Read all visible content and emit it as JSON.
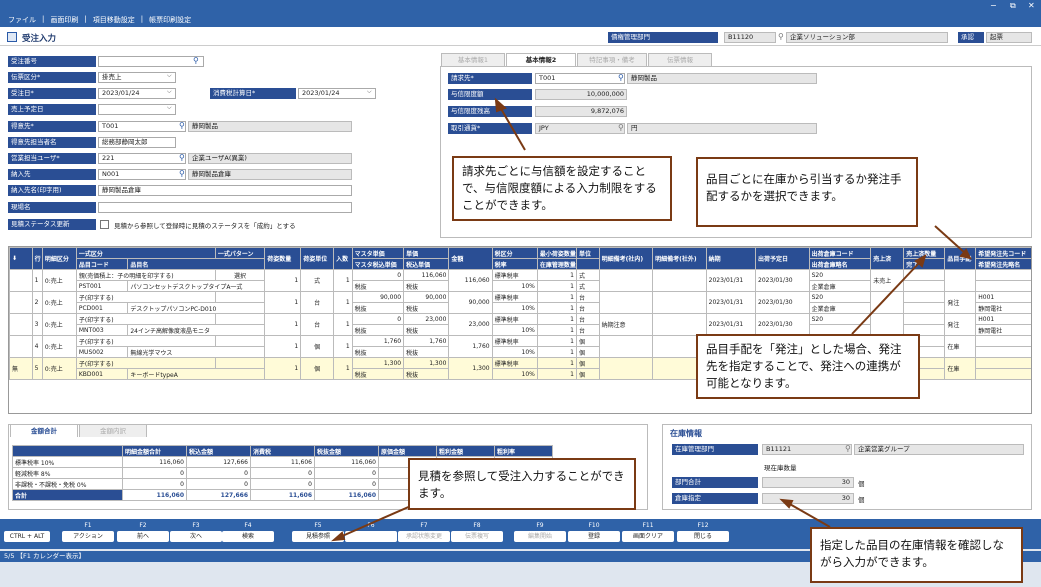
{
  "window": {
    "min": "−",
    "restore": "⧉",
    "close": "✕"
  },
  "menu": [
    "ファイル",
    "|",
    "画面印刷",
    "|",
    "項目移動設定",
    "|",
    "帳票印刷設定"
  ],
  "page": {
    "title": "受注入力"
  },
  "header": {
    "dept_label": "債権管理部門",
    "dept_code": "B11120",
    "dept_name": "企業ソリューション部",
    "approve_label": "承認",
    "approve_value": "起票"
  },
  "form": {
    "order_no_label": "受注番号",
    "order_no": "",
    "slip_type_label": "伝票区分*",
    "slip_type": "掛売上",
    "order_date_label": "受注日*",
    "order_date": "2023/01/24",
    "tax_date_label": "消費税計算日*",
    "tax_date": "2023/01/24",
    "sales_plan_label": "売上予定日",
    "sales_plan": "",
    "customer_label": "得意先*",
    "customer_code": "T001",
    "customer_name": "静岡製品",
    "contact_label": "得意先担当者名",
    "contact": "総務部静岡太郎",
    "rep_label": "営業担当ユーザ*",
    "rep_code": "221",
    "rep_name": "企業ユーザA(異業)",
    "ship_label": "納入先",
    "ship_code": "N001",
    "ship_name": "静岡製品倉庫",
    "ship_name_label": "納入先名(印字用)",
    "ship_name_print": "静岡製品倉庫",
    "site_label": "現場名",
    "site": "",
    "quote_label": "見積ステータス更新",
    "quote_text": "見積から参照して登録時に見積のステータスを「成約」とする"
  },
  "tabs": [
    "基本情報1",
    "基本情報2",
    "特記事項・備考",
    "伝票情報"
  ],
  "basic2": {
    "bill_label": "請求先*",
    "bill_code": "T001",
    "bill_name": "静岡製品",
    "limit_label": "与信限度額",
    "limit": "10,000,000",
    "limit_rest_label": "与信限度残高",
    "limit_rest": "9,872,076",
    "currency_label": "取引通貨*",
    "currency_code": "JPY",
    "currency_name": "円"
  },
  "grid": {
    "h1": [
      "行",
      "明細区分",
      "一式区分",
      "一式パターン",
      "荷姿数量",
      "荷姿単位",
      "入数",
      "マスタ単価",
      "単価",
      "金額",
      "税区分",
      "最小荷姿数量",
      "単位",
      "明細備考(社内)",
      "明細備考(社外)",
      "納期",
      "出荷予定日",
      "出荷倉庫コード",
      "売上済",
      "売上済数量",
      "品目手配",
      "希望発注先コード"
    ],
    "h2": [
      "品目コード",
      "品目名",
      "マスタ税込単価",
      "税込単価",
      "税率",
      "在庫管理数量",
      "出荷倉庫略名",
      "完了",
      "希望発注先略名"
    ],
    "rows": [
      {
        "no": "1",
        "kind": "0:売上",
        "set": "親(売価積上：子の明細を印字する)",
        "pattern": "選択",
        "code": "PST001",
        "name": "パソコンセットデスクトップタイプA一式",
        "qty": "1",
        "unit": "式",
        "inner": "1",
        "m_price": "0",
        "price": "116,060",
        "amount": "116,060",
        "tax": "標準税率",
        "min": "1",
        "tax_rate": "10%",
        "stock": "1",
        "u": "式",
        "memo_in": "",
        "due": "2023/01/31",
        "ship": "2023/01/30",
        "wh": "S20",
        "wh_name": "企業倉庫",
        "sold": "未売上",
        "arrange": "",
        "vendor": "",
        "vendor_name": "",
        "taxlbl": "税抜"
      },
      {
        "no": "2",
        "kind": "0:売上",
        "set": "子(印字する)",
        "pattern": "",
        "code": "PCD001",
        "name": "デスクトップパソコンPC-D010",
        "qty": "1",
        "unit": "台",
        "inner": "1",
        "m_price": "90,000",
        "price": "90,000",
        "amount": "90,000",
        "tax": "標準税率",
        "min": "1",
        "tax_rate": "10%",
        "stock": "1",
        "u": "台",
        "memo_in": "",
        "due": "2023/01/31",
        "ship": "2023/01/30",
        "wh": "S20",
        "wh_name": "企業倉庫",
        "sold": "",
        "arrange": "発注",
        "vendor": "H001",
        "vendor_name": "静岡電社",
        "taxlbl": "税抜"
      },
      {
        "no": "3",
        "kind": "0:売上",
        "set": "子(印字する)",
        "pattern": "",
        "code": "MNT003",
        "name": "24インチ高解像度液晶モニタ",
        "qty": "1",
        "unit": "台",
        "inner": "1",
        "m_price": "0",
        "price": "23,000",
        "amount": "23,000",
        "tax": "標準税率",
        "min": "1",
        "tax_rate": "10%",
        "stock": "1",
        "u": "台",
        "memo_in": "納期注意",
        "due": "2023/01/31",
        "ship": "2023/01/30",
        "wh": "S20",
        "wh_name": "",
        "sold": "",
        "arrange": "発注",
        "vendor": "H001",
        "vendor_name": "静岡電社",
        "taxlbl": "税抜"
      },
      {
        "no": "4",
        "kind": "0:売上",
        "set": "子(印字する)",
        "pattern": "",
        "code": "MUS002",
        "name": "無線光学マウス",
        "qty": "1",
        "unit": "個",
        "inner": "1",
        "m_price": "1,760",
        "price": "1,760",
        "amount": "1,760",
        "tax": "標準税率",
        "min": "1",
        "tax_rate": "10%",
        "stock": "1",
        "u": "個",
        "memo_in": "",
        "due": "",
        "ship": "",
        "wh": "",
        "wh_name": "",
        "sold": "",
        "arrange": "在庫",
        "vendor": "",
        "vendor_name": "",
        "taxlbl": "税抜"
      },
      {
        "no": "5",
        "kind": "0:売上",
        "set": "子(印字する)",
        "pattern": "",
        "code": "KBD001",
        "name": "キーボードtypeA",
        "qty": "1",
        "unit": "個",
        "inner": "1",
        "m_price": "1,300",
        "price": "1,300",
        "amount": "1,300",
        "tax": "標準税率",
        "min": "1",
        "tax_rate": "10%",
        "stock": "1",
        "u": "個",
        "memo_in": "",
        "due": "",
        "ship": "",
        "wh": "",
        "wh_name": "",
        "sold": "",
        "arrange": "在庫",
        "vendor": "",
        "vendor_name": "",
        "taxlbl": "税抜"
      }
    ],
    "row5_mark": "無"
  },
  "totals": {
    "tabs": [
      "金額合計",
      "金額内訳"
    ],
    "headers": [
      "明細金額合計",
      "税込金額",
      "消費税",
      "税抜金額",
      "原価金額",
      "粗利金額",
      "粗利率"
    ],
    "rows": [
      {
        "label": "標準税率 10%",
        "v": [
          "116,060",
          "127,666",
          "11,606",
          "116,060",
          "",
          "",
          ""
        ]
      },
      {
        "label": "軽減税率 8%",
        "v": [
          "0",
          "0",
          "0",
          "0",
          "",
          "",
          ""
        ]
      },
      {
        "label": "非課税・不課税・免税 0%",
        "v": [
          "0",
          "0",
          "0",
          "0",
          "",
          "",
          ""
        ]
      },
      {
        "label": "合計",
        "v": [
          "116,060",
          "127,666",
          "11,606",
          "116,060",
          "",
          "",
          ""
        ]
      }
    ]
  },
  "stock": {
    "title": "在庫情報",
    "dept_label": "在庫管理部門",
    "dept_code": "B11121",
    "dept_name": "企業営業グループ",
    "qty_label": "現在庫数量",
    "dept_total_label": "部門合計",
    "dept_total": "30",
    "warehouse_label": "倉庫指定",
    "warehouse_qty": "30",
    "unit": "個"
  },
  "fkeys": [
    {
      "k": "",
      "b": "CTRL + ALT",
      "dis": false
    },
    {
      "k": "F1",
      "b": "アクション",
      "dis": false
    },
    {
      "k": "F2",
      "b": "前へ",
      "dis": false
    },
    {
      "k": "F3",
      "b": "次へ",
      "dis": false
    },
    {
      "k": "F4",
      "b": "検索",
      "dis": false
    },
    {
      "k": "F5",
      "b": "見積参照",
      "dis": false
    },
    {
      "k": "F6",
      "b": "",
      "dis": true
    },
    {
      "k": "F7",
      "b": "承認状態変更",
      "dis": true
    },
    {
      "k": "F8",
      "b": "伝票複写",
      "dis": true
    },
    {
      "k": "F9",
      "b": "編集開始",
      "dis": true
    },
    {
      "k": "F10",
      "b": "登録",
      "dis": false
    },
    {
      "k": "F11",
      "b": "画面クリア",
      "dis": false
    },
    {
      "k": "F12",
      "b": "閉じる",
      "dis": false
    }
  ],
  "status": {
    "text": "5/5 【F1 カレンダー表示】"
  },
  "callouts": {
    "c1": "請求先ごとに与信額を設定することで、与信限度額による入力制限をすることができます。",
    "c2": "品目ごとに在庫から引当するか発注手配するかを選択できます。",
    "c3": "品目手配を「発注」とした場合、発注先を指定することで、発注への連携が可能となります。",
    "c4": "見積を参照して受注入力することができます。",
    "c5": "指定した品目の在庫情報を確認しながら入力ができます。"
  }
}
